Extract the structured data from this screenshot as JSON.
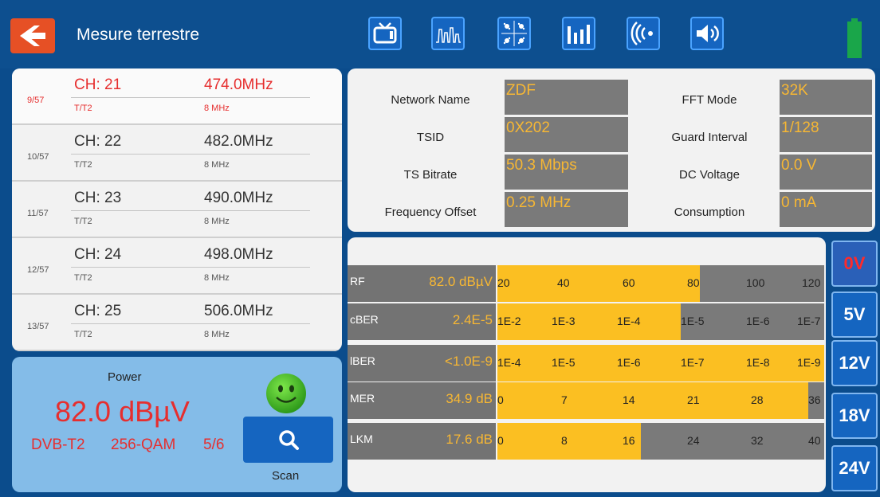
{
  "header": {
    "title": "Mesure terrestre",
    "icons": [
      "tv-icon",
      "spectrum-icon",
      "constellation-icon",
      "bar-graph-icon",
      "signal-wave-icon",
      "speaker-icon"
    ],
    "battery_color": "#1aa64a"
  },
  "channels": [
    {
      "index": "9/57",
      "name": "CH: 21",
      "freq": "474.0MHz",
      "mod": "T/T2",
      "bw": "8 MHz",
      "selected": true
    },
    {
      "index": "10/57",
      "name": "CH: 22",
      "freq": "482.0MHz",
      "mod": "T/T2",
      "bw": "8 MHz"
    },
    {
      "index": "11/57",
      "name": "CH: 23",
      "freq": "490.0MHz",
      "mod": "T/T2",
      "bw": "8 MHz"
    },
    {
      "index": "12/57",
      "name": "CH: 24",
      "freq": "498.0MHz",
      "mod": "T/T2",
      "bw": "8 MHz"
    },
    {
      "index": "13/57",
      "name": "CH: 25",
      "freq": "506.0MHz",
      "mod": "T/T2",
      "bw": "8 MHz"
    }
  ],
  "power": {
    "label": "Power",
    "value": "82.0 dBµV",
    "system": "DVB-T2",
    "qam": "256-QAM",
    "code_rate": "5/6",
    "scan_label": "Scan"
  },
  "info": {
    "network_name_label": "Network Name",
    "network_name": "ZDF",
    "tsid_label": "TSID",
    "tsid": "0X202",
    "ts_bitrate_label": "TS Bitrate",
    "ts_bitrate": "50.3 Mbps",
    "freq_offset_label": "Frequency Offset",
    "freq_offset": "0.25 MHz",
    "fft_mode_label": "FFT Mode",
    "fft_mode": "32K",
    "guard_label": "Guard Interval",
    "guard": "1/128",
    "dc_voltage_label": "DC Voltage",
    "dc_voltage": "0.0 V",
    "consumption_label": "Consumption",
    "consumption": "0 mA"
  },
  "meters": [
    {
      "name": "RF",
      "value": "82.0 dBµV",
      "fill": 0.62,
      "ticks": [
        "20",
        "40",
        "60",
        "80",
        "100",
        "120"
      ]
    },
    {
      "name": "cBER",
      "value": "2.4E-5",
      "fill": 0.56,
      "ticks": [
        "1E-2",
        "1E-3",
        "1E-4",
        "1E-5",
        "1E-6",
        "1E-7"
      ]
    },
    {
      "name": "lBER",
      "value": "<1.0E-9",
      "fill": 1.0,
      "ticks": [
        "1E-4",
        "1E-5",
        "1E-6",
        "1E-7",
        "1E-8",
        "1E-9"
      ]
    },
    {
      "name": "MER",
      "value": "34.9 dB",
      "fill": 0.95,
      "ticks": [
        "0",
        "7",
        "14",
        "21",
        "28",
        "36"
      ]
    },
    {
      "name": "LKM",
      "value": "17.6 dB",
      "fill": 0.44,
      "ticks": [
        "0",
        "8",
        "16",
        "24",
        "32",
        "40"
      ]
    }
  ],
  "voltages": [
    {
      "label": "0V",
      "active": true
    },
    {
      "label": "5V"
    },
    {
      "label": "12V"
    },
    {
      "label": "18V"
    },
    {
      "label": "24V"
    }
  ],
  "colors": {
    "accent_red": "#e62e2e",
    "value_yellow": "#f7b733",
    "bar_fill": "#fbbf22",
    "back_button": "#e65025"
  }
}
